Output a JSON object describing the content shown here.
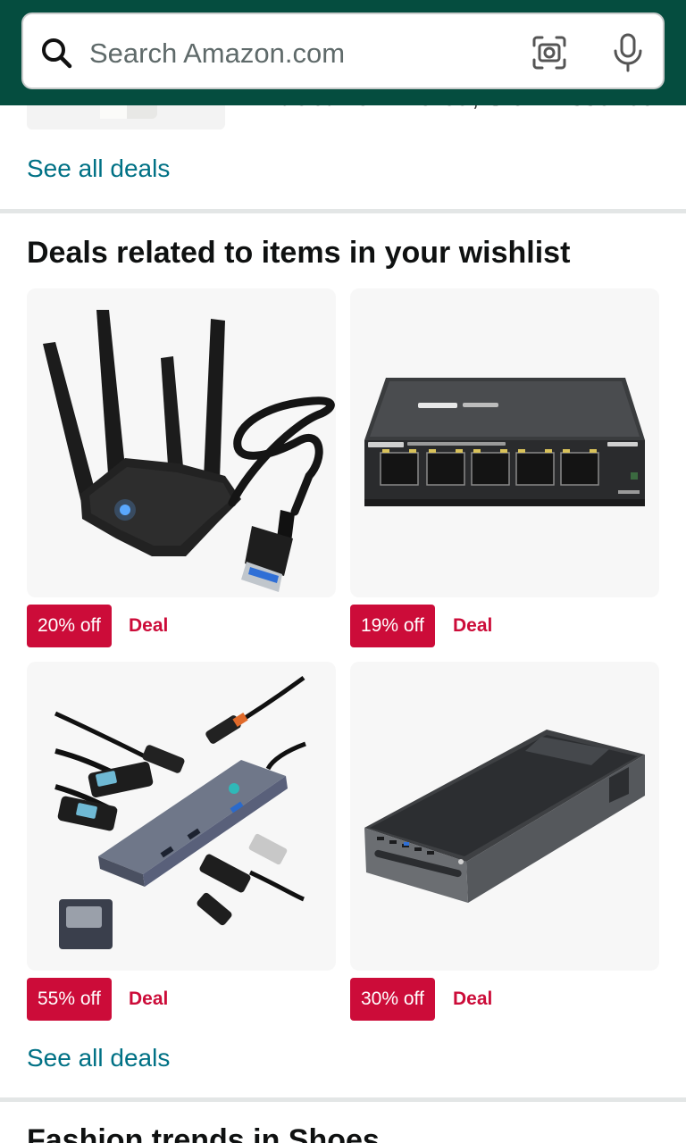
{
  "search": {
    "placeholder": "Search Amazon.com"
  },
  "previous_section": {
    "partial_text": "Extract from Korea, Slow Essence",
    "see_all": "See all deals"
  },
  "wishlist_section": {
    "title": "Deals related to items in your wishlist",
    "see_all": "See all deals",
    "products": [
      {
        "image": "wifi-adapter-image",
        "discount": "20% off",
        "label": "Deal"
      },
      {
        "image": "network-switch-image",
        "discount": "19% off",
        "label": "Deal"
      },
      {
        "image": "usb-hub-image",
        "discount": "55% off",
        "label": "Deal"
      },
      {
        "image": "monitor-stand-image",
        "discount": "30% off",
        "label": "Deal"
      }
    ]
  },
  "next_section": {
    "title": "Fashion trends in Shoes"
  },
  "colors": {
    "header": "#054d3f",
    "link": "#007185",
    "deal_red": "#cc0c39"
  }
}
